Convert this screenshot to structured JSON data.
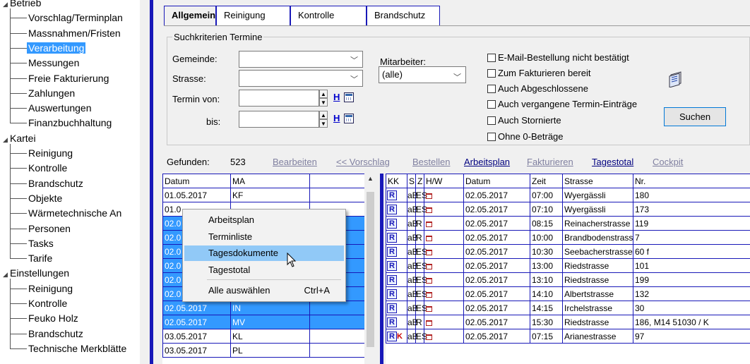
{
  "tree": {
    "groups": [
      {
        "label": "Betrieb",
        "items": [
          "Vorschlag/Terminplan",
          "Massnahmen/Fristen",
          "Verarbeitung",
          "Messungen",
          "Freie Fakturierung",
          "Zahlungen",
          "Auswertungen",
          "Finanzbuchhaltung"
        ]
      },
      {
        "label": "Kartei",
        "items": [
          "Reinigung",
          "Kontrolle",
          "Brandschutz",
          "Objekte",
          "Wärmetechnische An",
          "Personen",
          "Tasks",
          "Tarife"
        ]
      },
      {
        "label": "Einstellungen",
        "items": [
          "Reinigung",
          "Kontrolle",
          "Feuko Holz",
          "Brandschutz",
          "Technische Merkblätte"
        ]
      }
    ],
    "selected": "Verarbeitung"
  },
  "tabs": [
    "Allgemein",
    "Reinigung",
    "Kontrolle",
    "Brandschutz"
  ],
  "active_tab": "Allgemein",
  "search": {
    "title": "Suchkriterien Termine",
    "gemeinde_label": "Gemeinde:",
    "strasse_label": "Strasse:",
    "termin_von_label": "Termin von:",
    "bis_label": "bis:",
    "h_button": "H",
    "mitarbeiter_label": "Mitarbeiter:",
    "mitarbeiter_value": "(alle)",
    "checkboxes": [
      "E-Mail-Bestellung nicht bestätigt",
      "Zum Fakturieren bereit",
      "Auch Abgeschlossene",
      "Auch vergangene Termin-Einträge",
      "Auch Stornierte",
      "Ohne 0-Beträge"
    ],
    "suchen_label": "Suchen"
  },
  "results": {
    "gefunden_label": "Gefunden:",
    "count": "523",
    "links": [
      {
        "label": "Bearbeiten",
        "enabled": false
      },
      {
        "label": "<< Vorschlag",
        "enabled": false
      },
      {
        "label": "Bestellen",
        "enabled": false
      },
      {
        "label": "Arbeitsplan",
        "enabled": true
      },
      {
        "label": "Fakturieren",
        "enabled": false
      },
      {
        "label": "Tagestotal",
        "enabled": true
      },
      {
        "label": "Cockpit",
        "enabled": false
      }
    ]
  },
  "left_grid": {
    "columns": [
      "Datum",
      "MA",
      ""
    ],
    "rows": [
      {
        "datum": "01.05.2017",
        "ma": "KF",
        "selected": false
      },
      {
        "datum": "01.0",
        "ma": "",
        "selected": false
      },
      {
        "datum": "02.0",
        "ma": "",
        "selected": true
      },
      {
        "datum": "02.0",
        "ma": "",
        "selected": true
      },
      {
        "datum": "02.0",
        "ma": "",
        "selected": true
      },
      {
        "datum": "02.0",
        "ma": "",
        "selected": true
      },
      {
        "datum": "02.0",
        "ma": "",
        "selected": true
      },
      {
        "datum": "02.0",
        "ma": "",
        "selected": true
      },
      {
        "datum": "02.05.2017",
        "ma": "IN",
        "selected": true
      },
      {
        "datum": "02.05.2017",
        "ma": "MV",
        "selected": true
      },
      {
        "datum": "03.05.2017",
        "ma": "KL",
        "selected": false
      },
      {
        "datum": "03.05.2017",
        "ma": "PL",
        "selected": false
      }
    ]
  },
  "right_grid": {
    "columns": [
      "KK",
      "S",
      "Z",
      "H/W",
      "Datum",
      "Zeit",
      "Strasse",
      "Nr."
    ],
    "rows": [
      {
        "kk": "R",
        "k": "",
        "s": "aB",
        "z": "ES",
        "datum": "02.05.2017",
        "zeit": "07:00",
        "strasse": "Wyergässli",
        "nr": "180"
      },
      {
        "kk": "R",
        "k": "",
        "s": "aB",
        "z": "ES",
        "datum": "02.05.2017",
        "zeit": "07:10",
        "strasse": "Wyergässli",
        "nr": "173"
      },
      {
        "kk": "R",
        "k": "",
        "s": "aB",
        "z": "R",
        "datum": "02.05.2017",
        "zeit": "08:15",
        "strasse": "Reinacherstrasse",
        "nr": "119"
      },
      {
        "kk": "R",
        "k": "",
        "s": "aB",
        "z": "R",
        "datum": "02.05.2017",
        "zeit": "10:00",
        "strasse": "Brandbodenstrass",
        "nr": "7"
      },
      {
        "kk": "R",
        "k": "",
        "s": "aB",
        "z": "ES",
        "datum": "02.05.2017",
        "zeit": "10:30",
        "strasse": "Seebacherstrasse",
        "nr": "60 f"
      },
      {
        "kk": "R",
        "k": "",
        "s": "aB",
        "z": "ES",
        "datum": "02.05.2017",
        "zeit": "13:00",
        "strasse": "Riedstrasse",
        "nr": "101"
      },
      {
        "kk": "R",
        "k": "",
        "s": "aB",
        "z": "ES",
        "datum": "02.05.2017",
        "zeit": "13:10",
        "strasse": "Riedstrasse",
        "nr": "199"
      },
      {
        "kk": "R",
        "k": "",
        "s": "aB",
        "z": "ES",
        "datum": "02.05.2017",
        "zeit": "14:10",
        "strasse": "Albertstrasse",
        "nr": "132"
      },
      {
        "kk": "R",
        "k": "",
        "s": "aB",
        "z": "ES",
        "datum": "02.05.2017",
        "zeit": "14:15",
        "strasse": "Irchelstrasse",
        "nr": "30"
      },
      {
        "kk": "R",
        "k": "",
        "s": "aB",
        "z": "R",
        "datum": "02.05.2017",
        "zeit": "15:30",
        "strasse": "Riedstrasse",
        "nr": "186, M14 51030 / K"
      },
      {
        "kk": "R",
        "k": "K",
        "s": "aB",
        "z": "ES",
        "datum": "02.05.2017",
        "zeit": "07:15",
        "strasse": "Arianestrasse",
        "nr": "97"
      }
    ]
  },
  "context_menu": {
    "items": [
      {
        "label": "Arbeitsplan",
        "shortcut": ""
      },
      {
        "label": "Terminliste",
        "shortcut": ""
      },
      {
        "label": "Tagesdokumente",
        "shortcut": ""
      },
      {
        "label": "Tagestotal",
        "shortcut": ""
      },
      {
        "label": "Alle auswählen",
        "shortcut": "Ctrl+A"
      }
    ],
    "hovered": "Tagesdokumente"
  }
}
